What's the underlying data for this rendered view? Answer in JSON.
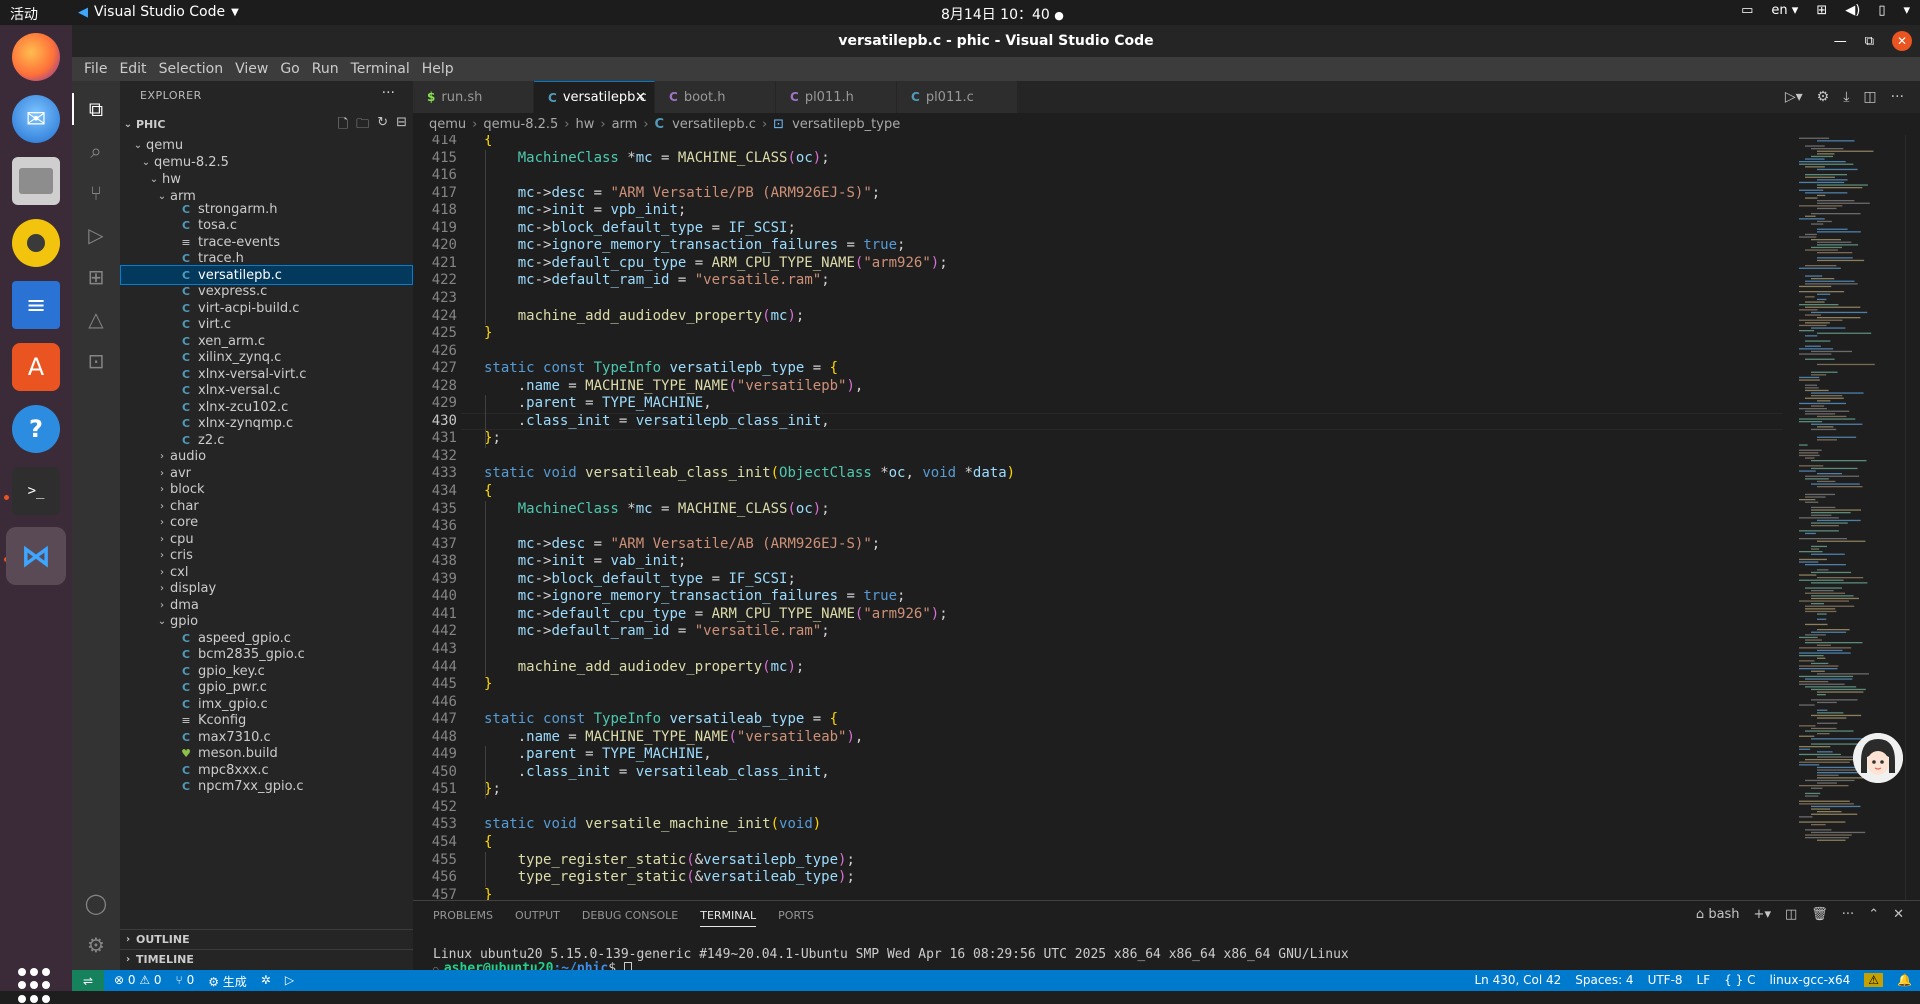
{
  "topbar": {
    "activities": "活动",
    "app_name": "Visual Studio Code",
    "clock": "8月14日  10：40",
    "lang": "en"
  },
  "window": {
    "title": "versatilepb.c - phic - Visual Studio Code"
  },
  "menubar": [
    "File",
    "Edit",
    "Selection",
    "View",
    "Go",
    "Run",
    "Terminal",
    "Help"
  ],
  "explorer": {
    "header": "EXPLORER",
    "project": "PHIC",
    "tree": [
      {
        "label": "qemu",
        "type": "folder",
        "depth": 1,
        "open": true
      },
      {
        "label": "qemu-8.2.5",
        "type": "folder",
        "depth": 2,
        "open": true
      },
      {
        "label": "hw",
        "type": "folder",
        "depth": 3,
        "open": true
      },
      {
        "label": "arm",
        "type": "folder",
        "depth": 4,
        "open": true
      },
      {
        "label": "strongarm.h",
        "type": "c",
        "depth": 5
      },
      {
        "label": "tosa.c",
        "type": "c",
        "depth": 5
      },
      {
        "label": "trace-events",
        "type": "txt",
        "depth": 5
      },
      {
        "label": "trace.h",
        "type": "c",
        "depth": 5
      },
      {
        "label": "versatilepb.c",
        "type": "c",
        "depth": 5,
        "selected": true
      },
      {
        "label": "vexpress.c",
        "type": "c",
        "depth": 5
      },
      {
        "label": "virt-acpi-build.c",
        "type": "c",
        "depth": 5
      },
      {
        "label": "virt.c",
        "type": "c",
        "depth": 5
      },
      {
        "label": "xen_arm.c",
        "type": "c",
        "depth": 5
      },
      {
        "label": "xilinx_zynq.c",
        "type": "c",
        "depth": 5
      },
      {
        "label": "xlnx-versal-virt.c",
        "type": "c",
        "depth": 5
      },
      {
        "label": "xlnx-versal.c",
        "type": "c",
        "depth": 5
      },
      {
        "label": "xlnx-zcu102.c",
        "type": "c",
        "depth": 5
      },
      {
        "label": "xlnx-zynqmp.c",
        "type": "c",
        "depth": 5
      },
      {
        "label": "z2.c",
        "type": "c",
        "depth": 5
      },
      {
        "label": "audio",
        "type": "folder",
        "depth": 4,
        "open": false
      },
      {
        "label": "avr",
        "type": "folder",
        "depth": 4,
        "open": false
      },
      {
        "label": "block",
        "type": "folder",
        "depth": 4,
        "open": false
      },
      {
        "label": "char",
        "type": "folder",
        "depth": 4,
        "open": false
      },
      {
        "label": "core",
        "type": "folder",
        "depth": 4,
        "open": false
      },
      {
        "label": "cpu",
        "type": "folder",
        "depth": 4,
        "open": false
      },
      {
        "label": "cris",
        "type": "folder",
        "depth": 4,
        "open": false
      },
      {
        "label": "cxl",
        "type": "folder",
        "depth": 4,
        "open": false
      },
      {
        "label": "display",
        "type": "folder",
        "depth": 4,
        "open": false
      },
      {
        "label": "dma",
        "type": "folder",
        "depth": 4,
        "open": false
      },
      {
        "label": "gpio",
        "type": "folder",
        "depth": 4,
        "open": true
      },
      {
        "label": "aspeed_gpio.c",
        "type": "c",
        "depth": 5
      },
      {
        "label": "bcm2835_gpio.c",
        "type": "c",
        "depth": 5
      },
      {
        "label": "gpio_key.c",
        "type": "c",
        "depth": 5
      },
      {
        "label": "gpio_pwr.c",
        "type": "c",
        "depth": 5
      },
      {
        "label": "imx_gpio.c",
        "type": "c",
        "depth": 5
      },
      {
        "label": "Kconfig",
        "type": "txt",
        "depth": 5
      },
      {
        "label": "max7310.c",
        "type": "c",
        "depth": 5
      },
      {
        "label": "meson.build",
        "type": "mb",
        "depth": 5
      },
      {
        "label": "mpc8xxx.c",
        "type": "c",
        "depth": 5
      },
      {
        "label": "npcm7xx_gpio.c",
        "type": "c",
        "depth": 5
      }
    ],
    "outline": "OUTLINE",
    "timeline": "TIMELINE"
  },
  "tabs": [
    {
      "label": "run.sh",
      "icon": "$",
      "icon_color": "#89e051",
      "active": false
    },
    {
      "label": "versatilepb.c",
      "icon": "C",
      "icon_color": "#519aba",
      "active": true
    },
    {
      "label": "boot.h",
      "icon": "C",
      "icon_color": "#a074c4",
      "active": false
    },
    {
      "label": "pl011.h",
      "icon": "C",
      "icon_color": "#a074c4",
      "active": false
    },
    {
      "label": "pl011.c",
      "icon": "C",
      "icon_color": "#519aba",
      "active": false
    }
  ],
  "breadcrumb": [
    "qemu",
    "qemu-8.2.5",
    "hw",
    "arm",
    "versatilepb.c",
    "versatilepb_type"
  ],
  "code": {
    "current_line": 430,
    "lines": [
      {
        "n": "414",
        "html": "<span class='p'>{</span>"
      },
      {
        "n": "415",
        "html": "    <span class='t'>MachineClass</span> *<span class='v'>mc</span> = <span class='f'>MACHINE_CLASS</span><span class='pk'>(</span><span class='v'>oc</span><span class='pk'>)</span>;"
      },
      {
        "n": "416",
        "html": ""
      },
      {
        "n": "417",
        "html": "    <span class='v'>mc</span>-&gt;<span class='v'>desc</span> = <span class='s'>\"ARM Versatile/PB (ARM926EJ-S)\"</span>;"
      },
      {
        "n": "418",
        "html": "    <span class='v'>mc</span>-&gt;<span class='v'>init</span> = <span class='v'>vpb_init</span>;"
      },
      {
        "n": "419",
        "html": "    <span class='v'>mc</span>-&gt;<span class='v'>block_default_type</span> = <span class='v'>IF_SCSI</span>;"
      },
      {
        "n": "420",
        "html": "    <span class='v'>mc</span>-&gt;<span class='v'>ignore_memory_transaction_failures</span> = <span class='k'>true</span>;"
      },
      {
        "n": "421",
        "html": "    <span class='v'>mc</span>-&gt;<span class='v'>default_cpu_type</span> = <span class='f'>ARM_CPU_TYPE_NAME</span><span class='pk'>(</span><span class='s'>\"arm926\"</span><span class='pk'>)</span>;"
      },
      {
        "n": "422",
        "html": "    <span class='v'>mc</span>-&gt;<span class='v'>default_ram_id</span> = <span class='s'>\"versatile.ram\"</span>;"
      },
      {
        "n": "423",
        "html": ""
      },
      {
        "n": "424",
        "html": "    <span class='f'>machine_add_audiodev_property</span><span class='pk'>(</span><span class='v'>mc</span><span class='pk'>)</span>;"
      },
      {
        "n": "425",
        "html": "<span class='p'>}</span>"
      },
      {
        "n": "426",
        "html": ""
      },
      {
        "n": "427",
        "html": "<span class='k'>static</span> <span class='k'>const</span> <span class='t'>TypeInfo</span> <span class='v'>versatilepb_type</span> = <span class='p'>{</span>"
      },
      {
        "n": "428",
        "html": "    .<span class='v'>name</span> = <span class='f'>MACHINE_TYPE_NAME</span><span class='pk'>(</span><span class='s'>\"versatilepb\"</span><span class='pk'>)</span>,"
      },
      {
        "n": "429",
        "html": "    .<span class='v'>parent</span> = <span class='v'>TYPE_MACHINE</span>,"
      },
      {
        "n": "430",
        "html": "    .<span class='v'>class_init</span> = <span class='v'>versatilepb_class_init</span>,"
      },
      {
        "n": "431",
        "html": "<span class='p'>}</span>;"
      },
      {
        "n": "432",
        "html": ""
      },
      {
        "n": "433",
        "html": "<span class='k'>static</span> <span class='k'>void</span> <span class='f'>versatileab_class_init</span><span class='p'>(</span><span class='t'>ObjectClass</span> *<span class='v'>oc</span>, <span class='k'>void</span> *<span class='v'>data</span><span class='p'>)</span>"
      },
      {
        "n": "434",
        "html": "<span class='p'>{</span>"
      },
      {
        "n": "435",
        "html": "    <span class='t'>MachineClass</span> *<span class='v'>mc</span> = <span class='f'>MACHINE_CLASS</span><span class='pk'>(</span><span class='v'>oc</span><span class='pk'>)</span>;"
      },
      {
        "n": "436",
        "html": ""
      },
      {
        "n": "437",
        "html": "    <span class='v'>mc</span>-&gt;<span class='v'>desc</span> = <span class='s'>\"ARM Versatile/AB (ARM926EJ-S)\"</span>;"
      },
      {
        "n": "438",
        "html": "    <span class='v'>mc</span>-&gt;<span class='v'>init</span> = <span class='v'>vab_init</span>;"
      },
      {
        "n": "439",
        "html": "    <span class='v'>mc</span>-&gt;<span class='v'>block_default_type</span> = <span class='v'>IF_SCSI</span>;"
      },
      {
        "n": "440",
        "html": "    <span class='v'>mc</span>-&gt;<span class='v'>ignore_memory_transaction_failures</span> = <span class='k'>true</span>;"
      },
      {
        "n": "441",
        "html": "    <span class='v'>mc</span>-&gt;<span class='v'>default_cpu_type</span> = <span class='f'>ARM_CPU_TYPE_NAME</span><span class='pk'>(</span><span class='s'>\"arm926\"</span><span class='pk'>)</span>;"
      },
      {
        "n": "442",
        "html": "    <span class='v'>mc</span>-&gt;<span class='v'>default_ram_id</span> = <span class='s'>\"versatile.ram\"</span>;"
      },
      {
        "n": "443",
        "html": ""
      },
      {
        "n": "444",
        "html": "    <span class='f'>machine_add_audiodev_property</span><span class='pk'>(</span><span class='v'>mc</span><span class='pk'>)</span>;"
      },
      {
        "n": "445",
        "html": "<span class='p'>}</span>"
      },
      {
        "n": "446",
        "html": ""
      },
      {
        "n": "447",
        "html": "<span class='k'>static</span> <span class='k'>const</span> <span class='t'>TypeInfo</span> <span class='v'>versatileab_type</span> = <span class='p'>{</span>"
      },
      {
        "n": "448",
        "html": "    .<span class='v'>name</span> = <span class='f'>MACHINE_TYPE_NAME</span><span class='pk'>(</span><span class='s'>\"versatileab\"</span><span class='pk'>)</span>,"
      },
      {
        "n": "449",
        "html": "    .<span class='v'>parent</span> = <span class='v'>TYPE_MACHINE</span>,"
      },
      {
        "n": "450",
        "html": "    .<span class='v'>class_init</span> = <span class='v'>versatileab_class_init</span>,"
      },
      {
        "n": "451",
        "html": "<span class='p'>}</span>;"
      },
      {
        "n": "452",
        "html": ""
      },
      {
        "n": "453",
        "html": "<span class='k'>static</span> <span class='k'>void</span> <span class='f'>versatile_machine_init</span><span class='p'>(</span><span class='k'>void</span><span class='p'>)</span>"
      },
      {
        "n": "454",
        "html": "<span class='p'>{</span>"
      },
      {
        "n": "455",
        "html": "    <span class='f'>type_register_static</span><span class='pk'>(</span>&amp;<span class='v'>versatilepb_type</span><span class='pk'>)</span>;"
      },
      {
        "n": "456",
        "html": "    <span class='f'>type_register_static</span><span class='pk'>(</span>&amp;<span class='v'>versatileab_type</span><span class='pk'>)</span>;"
      },
      {
        "n": "457",
        "html": "<span class='p'>}</span>"
      }
    ]
  },
  "panel": {
    "tabs": [
      "PROBLEMS",
      "OUTPUT",
      "DEBUG CONSOLE",
      "TERMINAL",
      "PORTS"
    ],
    "active_tab": "TERMINAL",
    "shell": "bash",
    "terminal_line1": "Linux ubuntu20 5.15.0-139-generic #149~20.04.1-Ubuntu SMP Wed Apr 16 08:29:56 UTC 2025 x86_64 x86_64 x86_64 GNU/Linux",
    "prompt_user": "asher@ubuntu20",
    "prompt_path": ":~/phic",
    "prompt_sym": "$ "
  },
  "statusbar": {
    "errors": "0",
    "warnings": "0",
    "ports": "0",
    "generate": "生成",
    "position": "Ln 430, Col 42",
    "spaces": "Spaces: 4",
    "encoding": "UTF-8",
    "eol": "LF",
    "language": "C",
    "config": "linux-gcc-x64"
  },
  "colors": {
    "accent": "#007acc",
    "selection": "#04395e",
    "ubuntu_orange": "#e95420"
  }
}
